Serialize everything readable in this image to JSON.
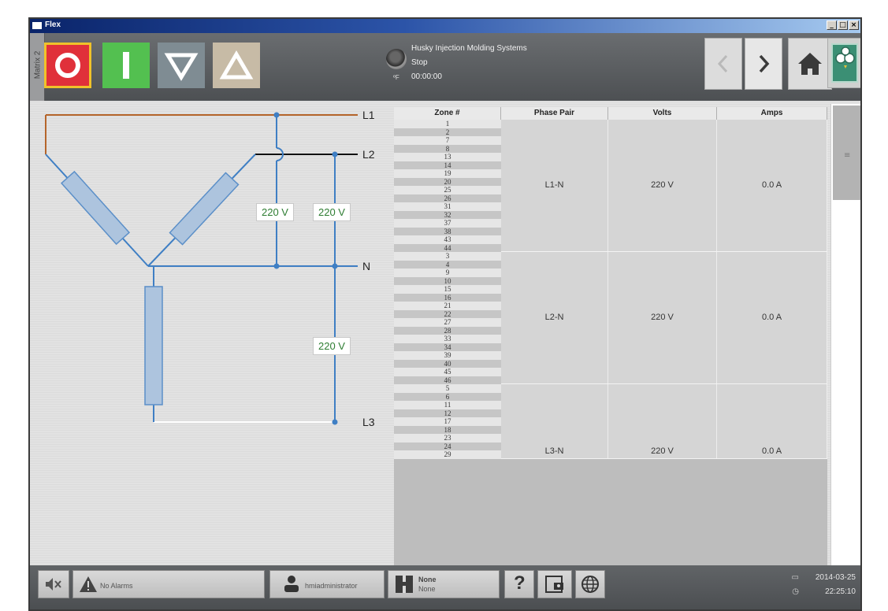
{
  "window": {
    "title": "Flex"
  },
  "toolbar": {
    "matrix_tab": "Matrix 2",
    "temp_unit": "ºF",
    "status": {
      "company": "Husky Injection Molding Systems",
      "state": "Stop",
      "timer": "00:00:00"
    }
  },
  "diagram": {
    "lines": [
      "L1",
      "L2",
      "N",
      "L3"
    ],
    "voltage_labels": [
      "220 V",
      "220 V",
      "220 V"
    ]
  },
  "table": {
    "headers": [
      "Zone #",
      "Phase Pair",
      "Volts",
      "Amps"
    ],
    "groups": [
      {
        "zones": [
          "1",
          "2",
          "7",
          "8",
          "13",
          "14",
          "19",
          "20",
          "25",
          "26",
          "31",
          "32",
          "37",
          "38",
          "43",
          "44"
        ],
        "phase_pair": "L1-N",
        "volts": "220 V",
        "amps": "0.0 A"
      },
      {
        "zones": [
          "3",
          "4",
          "9",
          "10",
          "15",
          "16",
          "21",
          "22",
          "27",
          "28",
          "33",
          "34",
          "39",
          "40",
          "45",
          "46"
        ],
        "phase_pair": "L2-N",
        "volts": "220 V",
        "amps": "0.0 A"
      },
      {
        "zones": [
          "5",
          "6",
          "11",
          "12",
          "17",
          "18",
          "23",
          "24",
          "29"
        ],
        "phase_pair": "L3-N",
        "volts": "220 V",
        "amps": "0.0 A"
      }
    ]
  },
  "statusbar": {
    "alarms": "No Alarms",
    "user": "hmiadministrator",
    "mold_title": "None",
    "mold_sub": "None",
    "date": "2014-03-25",
    "time": "22:25:10"
  },
  "colors": {
    "stop": "#e0303a",
    "start": "#53c050",
    "line_l1": "#b5652b",
    "line_blue": "#3f7fc4"
  }
}
